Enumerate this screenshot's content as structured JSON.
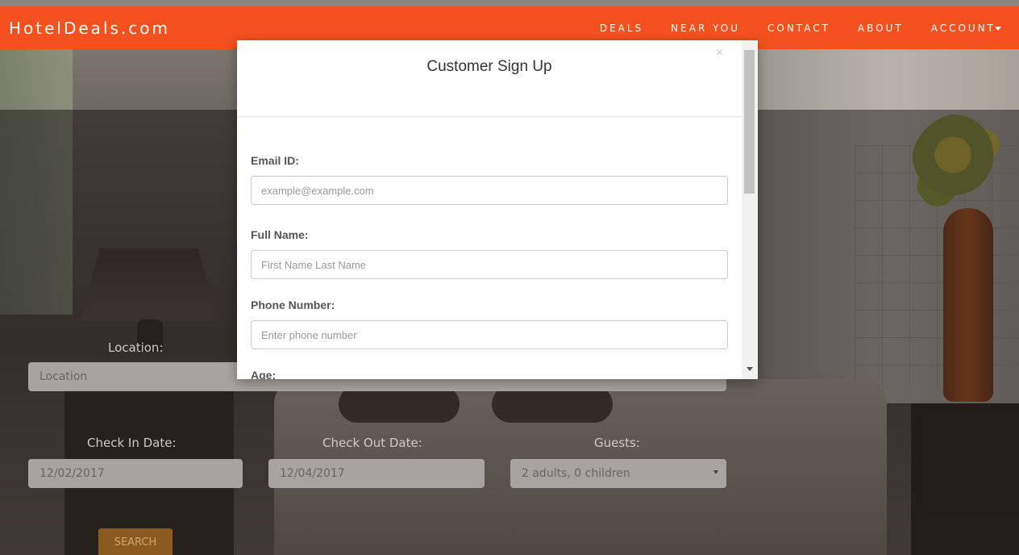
{
  "navbar": {
    "brand": "HotelDeals.com",
    "items": [
      "DEALS",
      "NEAR YOU",
      "CONTACT",
      "ABOUT",
      "ACCOUNT"
    ]
  },
  "search": {
    "location_label": "Location:",
    "location_placeholder": "Location",
    "checkin_label": "Check In Date:",
    "checkin_value": "12/02/2017",
    "checkout_label": "Check Out Date:",
    "checkout_value": "12/04/2017",
    "guests_label": "Guests:",
    "guests_value": "2 adults, 0 children",
    "search_label": "SEARCH"
  },
  "modal": {
    "title": "Customer Sign Up",
    "close": "×",
    "email_label": "Email ID:",
    "email_placeholder": "example@example.com",
    "name_label": "Full Name:",
    "name_placeholder": "First Name Last Name",
    "phone_label": "Phone Number:",
    "phone_placeholder": "Enter phone number",
    "age_label": "Age:"
  }
}
